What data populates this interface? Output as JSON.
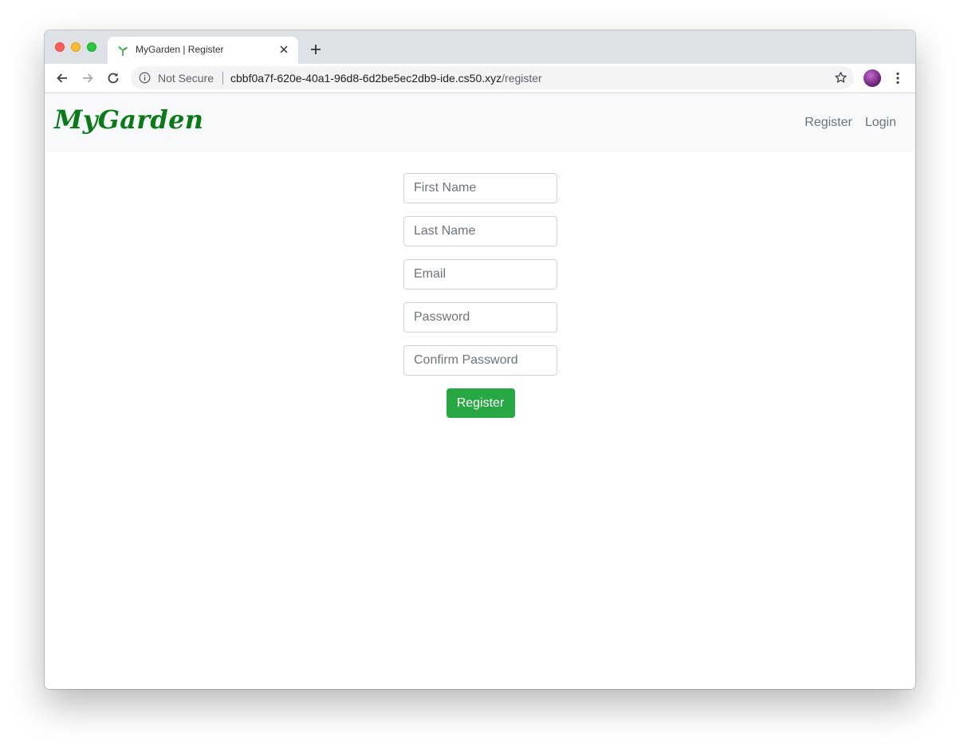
{
  "browser": {
    "tab": {
      "title": "MyGarden | Register",
      "favicon": "seedling-icon",
      "close_icon": "close-icon"
    },
    "new_tab_icon": "plus-icon",
    "address_bar": {
      "security_label": "Not Secure",
      "url_host": "cbbf0a7f-620e-40a1-96d8-6d2be5ec2db9-ide.cs50.xyz",
      "url_path": "/register"
    },
    "icons": [
      "back-icon",
      "forward-icon",
      "reload-icon",
      "info-icon",
      "star-icon",
      "avatar",
      "menu-icon"
    ]
  },
  "navbar": {
    "brand": "MyGarden",
    "brand_color": "#0a7a18",
    "links": [
      {
        "label": "Register"
      },
      {
        "label": "Login"
      }
    ]
  },
  "form": {
    "first_name": {
      "placeholder": "First Name",
      "value": ""
    },
    "last_name": {
      "placeholder": "Last Name",
      "value": ""
    },
    "email": {
      "placeholder": "Email",
      "value": ""
    },
    "password": {
      "placeholder": "Password",
      "value": ""
    },
    "confirm_password": {
      "placeholder": "Confirm Password",
      "value": ""
    },
    "submit_label": "Register",
    "submit_color": "#28a745"
  }
}
